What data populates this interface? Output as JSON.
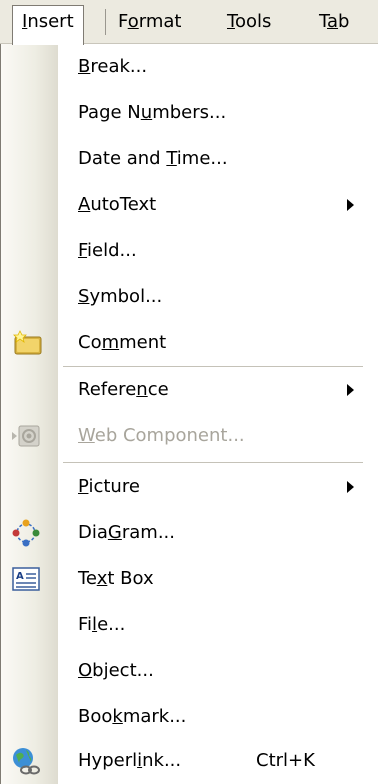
{
  "menubar": [
    {
      "label": "Insert",
      "u": "I",
      "active": true
    },
    {
      "label": "Format",
      "u": "o",
      "active": false
    },
    {
      "label": "Tools",
      "u": "T",
      "active": false
    },
    {
      "label": "Tab",
      "u": "a",
      "active": false
    }
  ],
  "menu": [
    {
      "label": "Break...",
      "u": "B"
    },
    {
      "label": "Page Numbers...",
      "u": "u"
    },
    {
      "label": "Date and Time...",
      "u": "T"
    },
    {
      "label": "AutoText",
      "u": "A",
      "submenu": true
    },
    {
      "label": "Field...",
      "u": "F"
    },
    {
      "label": "Symbol...",
      "u": "S"
    },
    {
      "label": "Comment",
      "u": "m",
      "icon": "comment-icon"
    },
    {
      "label": "Reference",
      "u": "n",
      "submenu": true
    },
    {
      "label": "Web Component...",
      "u": "W",
      "icon": "web-component-icon",
      "disabled": true
    },
    {
      "label": "Picture",
      "u": "P",
      "submenu": true
    },
    {
      "label": "Diagram...",
      "u": "G",
      "icon": "diagram-icon"
    },
    {
      "label": "Text Box",
      "u": "x",
      "icon": "text-box-icon"
    },
    {
      "label": "File...",
      "u": "l"
    },
    {
      "label": "Object...",
      "u": "O"
    },
    {
      "label": "Bookmark...",
      "u": "k"
    },
    {
      "label": "Hyperlink...",
      "u": "i",
      "shortcut": "Ctrl+K",
      "icon": "hyperlink-icon"
    }
  ]
}
